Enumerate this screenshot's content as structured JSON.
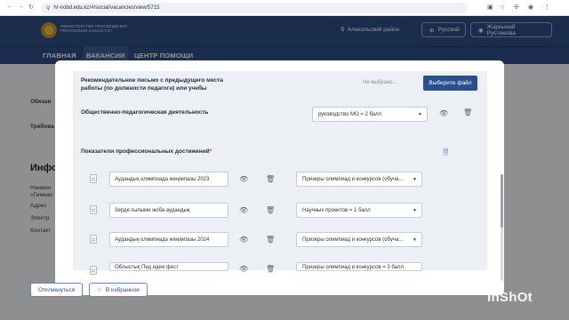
{
  "browser": {
    "url": "hr-nobd.edu.kz/#/social/vacancies/view/5715"
  },
  "header": {
    "ministry": "Министерство просвещения Республики Казахстан",
    "region": "Алакольский район",
    "language": "Русский",
    "user": "Жаркынай Рустемова"
  },
  "nav": {
    "items": [
      "ГЛАВНАЯ",
      "ВАКАНСИИ",
      "ЦЕНТР ПОМОЩИ"
    ]
  },
  "background": {
    "label_responsibilities": "Обязан",
    "label_requirements": "Требова",
    "info_heading": "Инфор",
    "field_1": "Наимен",
    "field_1b": "«Гимназ",
    "field_2": "Адрес :",
    "field_3": "Электр",
    "field_4": "Контакт",
    "respond_button": "Откликнуться",
    "favorites_button": "В избранное"
  },
  "modal": {
    "recommendation_label": "Рекомендательное письмо с предыдущего места работы (по должности педагога) или учебы",
    "file_placeholder": "Не выбрано...",
    "file_button": "Выберите файл",
    "activity_label": "Общественно-педагогическая деятельность",
    "activity_value": "руководство МО = 2 балл",
    "achievements_label": "Показатели профессиональных достижений",
    "achievements_required": "*",
    "rows": [
      {
        "text": "Аудандық олимпиада жеңімпазы 2023",
        "category": "Призеры олимпиад и конкурсов (обуча..."
      },
      {
        "text": "Зерде ғылыми жоба аудандық",
        "category": "Научных проектов = 1 балл"
      },
      {
        "text": "Аудандық олимпиада жеңімпазы 2024",
        "category": "Призеры олимпиад и конкурсов (обуча..."
      },
      {
        "text": "Облыстық Пед идея фест",
        "category": "Призеры олимпиад и конкурсов = 3 балл"
      }
    ]
  },
  "watermark": "InShOt",
  "colors": {
    "header_blue": "#2e4e86",
    "button_blue": "#2b4e8d",
    "required_red": "#d9322b"
  },
  "icons": [
    "back-icon",
    "forward-icon",
    "reload-icon",
    "lock-icon",
    "location-icon",
    "globe-icon",
    "user-icon",
    "eye-icon",
    "trash-icon",
    "document-icon",
    "add-file-icon",
    "star-icon"
  ]
}
